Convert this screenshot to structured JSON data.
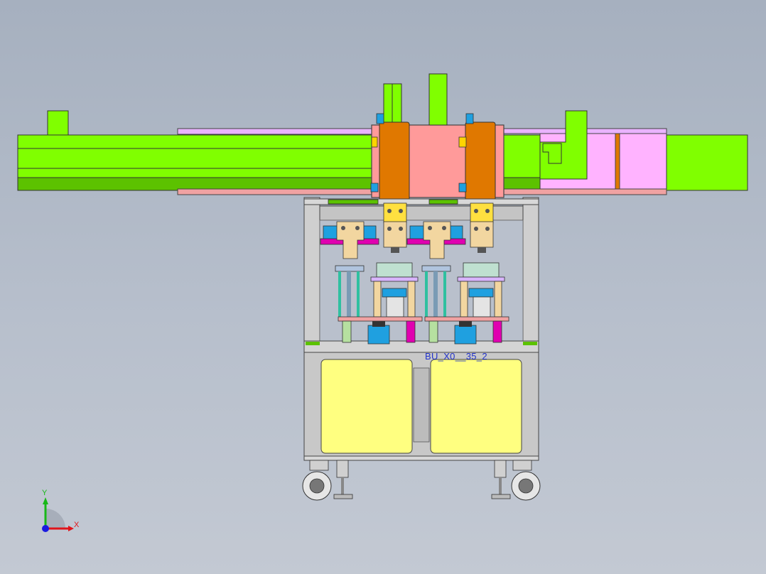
{
  "viewport": {
    "background_top": "#a6b0bf",
    "background_bottom": "#c3c9d3"
  },
  "annotation": {
    "text": "BU_X0__35_2",
    "color": "#2233cc"
  },
  "triad": {
    "x_label": "X",
    "y_label": "Y",
    "x_color": "#e0141b",
    "y_color": "#18b818",
    "z_color": "#1a1ae0"
  },
  "colors": {
    "rail_green": "#80ff00",
    "rail_dark": "#5cc200",
    "carriage_pink": "#ff9a9a",
    "orange_block": "#e07800",
    "magenta_pale": "#ffb3ff",
    "panel_yellow": "#ffff80",
    "frame_grey": "#c8c8c8",
    "cyan_part": "#1fa0e0",
    "beige_part": "#f2d6a0"
  }
}
